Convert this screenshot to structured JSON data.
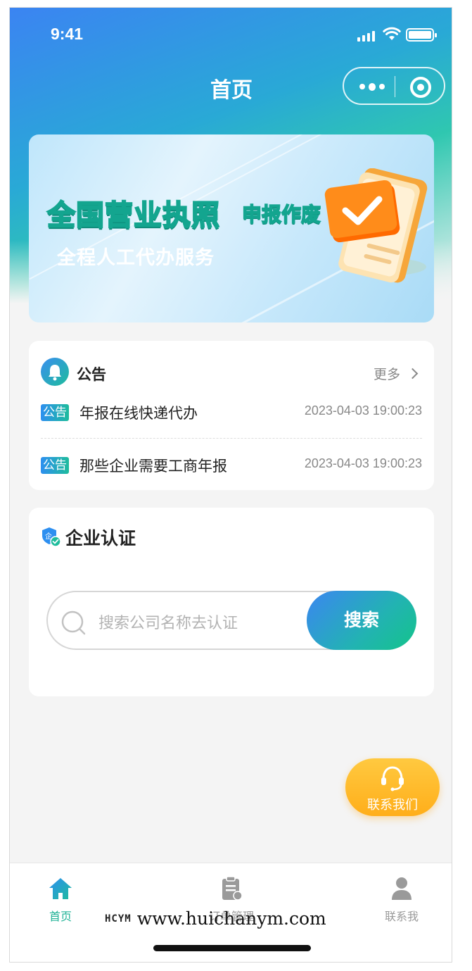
{
  "status_bar": {
    "time": "9:41"
  },
  "nav": {
    "title": "首页"
  },
  "banner": {
    "title": "全国营业执照",
    "subtitle": "申报作废",
    "tagline": "全程人工代办服务"
  },
  "notice": {
    "heading": "公告",
    "more_label": "更多",
    "items": [
      {
        "tag": "公告",
        "title": "年报在线快递代办",
        "date": "2023-04-03 19:00:23"
      },
      {
        "tag": "公告",
        "title": "那些企业需要工商年报",
        "date": "2023-04-03 19:00:23"
      }
    ]
  },
  "enterprise": {
    "heading": "企业认证",
    "search_placeholder": "搜索公司名称去认证",
    "search_button": "搜索"
  },
  "contact": {
    "label": "联系我们"
  },
  "tabbar": {
    "items": [
      {
        "label": "首页",
        "icon": "home-icon",
        "active": true
      },
      {
        "label": "订单管理",
        "icon": "order-clipboard-icon",
        "active": false
      },
      {
        "label": "联系我",
        "icon": "user-icon",
        "active": false
      }
    ]
  },
  "watermark": {
    "logo": "HCYM",
    "url": "www.huichanym.com"
  },
  "colors": {
    "accent_green": "#1db195",
    "accent_blue": "#3b86f1",
    "contact_orange": "#ffae1a"
  }
}
